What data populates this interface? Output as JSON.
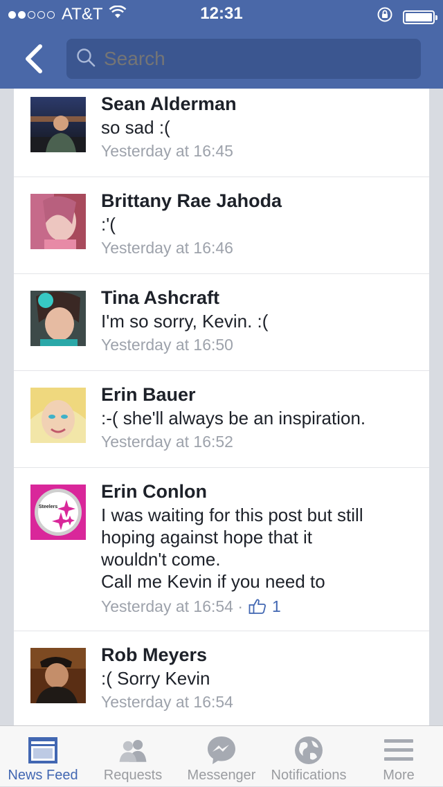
{
  "status_bar": {
    "carrier": "AT&T",
    "time": "12:31",
    "signal_bars_filled": 2,
    "signal_bars_total": 5,
    "battery_level": 1.0
  },
  "search": {
    "placeholder": "Search"
  },
  "colors": {
    "brand_blue": "#4a68a8",
    "search_bg": "#3b5690",
    "link_blue": "#4267b2",
    "muted_text": "#9da2ab"
  },
  "comments": [
    {
      "name": "Sean Alderman",
      "text": "so sad :(",
      "time": "Yesterday at 16:45",
      "likes": null
    },
    {
      "name": "Brittany Rae Jahoda",
      "text": ":'(",
      "time": "Yesterday at 16:46",
      "likes": null
    },
    {
      "name": "Tina Ashcraft",
      "text": "I'm so sorry, Kevin. :(",
      "time": "Yesterday at 16:50",
      "likes": null
    },
    {
      "name": "Erin Bauer",
      "text": ":-( she'll always be an inspiration.",
      "time": "Yesterday at 16:52",
      "likes": null
    },
    {
      "name": "Erin Conlon",
      "text": "I was waiting for this post but still\nhoping against hope that it\nwouldn't come.\nCall me Kevin if you need to",
      "time": "Yesterday at 16:54 ·",
      "likes": "1"
    },
    {
      "name": "Rob Meyers",
      "text": ":( Sorry Kevin",
      "time": "Yesterday at 16:54",
      "likes": null
    }
  ],
  "avatar_badge": "Steelers",
  "tabs": [
    {
      "label": "News Feed",
      "icon": "news-feed-icon",
      "active": true
    },
    {
      "label": "Requests",
      "icon": "friends-icon",
      "active": false
    },
    {
      "label": "Messenger",
      "icon": "messenger-icon",
      "active": false
    },
    {
      "label": "Notifications",
      "icon": "globe-icon",
      "active": false
    },
    {
      "label": "More",
      "icon": "menu-icon",
      "active": false
    }
  ]
}
